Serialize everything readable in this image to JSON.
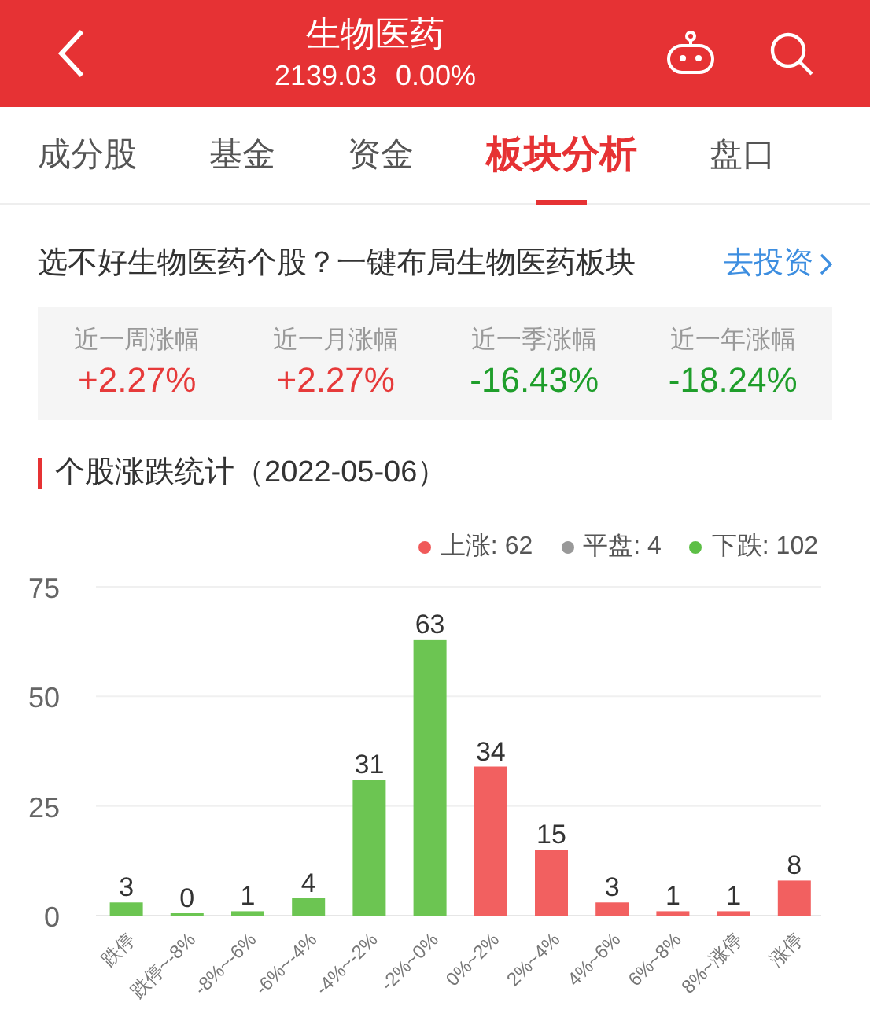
{
  "header": {
    "title": "生物医药",
    "price": "2139.03",
    "change": "0.00%"
  },
  "tabs": [
    {
      "label": "成分股",
      "selected": false
    },
    {
      "label": "基金",
      "selected": false
    },
    {
      "label": "资金",
      "selected": false
    },
    {
      "label": "板块分析",
      "selected": true
    },
    {
      "label": "盘口",
      "selected": false
    }
  ],
  "banner": {
    "text": "选不好生物医药个股？一键布局生物医药板块",
    "link": "去投资"
  },
  "stats": [
    {
      "label": "近一周涨幅",
      "value": "+2.27%",
      "color": "#e63a3a"
    },
    {
      "label": "近一月涨幅",
      "value": "+2.27%",
      "color": "#e63a3a"
    },
    {
      "label": "近一季涨幅",
      "value": "-16.43%",
      "color": "#1f9e2b"
    },
    {
      "label": "近一年涨幅",
      "value": "-18.24%",
      "color": "#1f9e2b"
    }
  ],
  "section_title": "个股涨跌统计（2022-05-06）",
  "legend": [
    {
      "label": "上涨: 62",
      "color": "#f05a5a"
    },
    {
      "label": "平盘: 4",
      "color": "#999999"
    },
    {
      "label": "下跌: 102",
      "color": "#5dbf46"
    }
  ],
  "chart_data": {
    "type": "bar",
    "categories": [
      "跌停",
      "跌停~-8%",
      "-8%~-6%",
      "-6%~-4%",
      "-4%~-2%",
      "-2%~0%",
      "0%~2%",
      "2%~4%",
      "4%~6%",
      "6%~8%",
      "8%~涨停",
      "涨停"
    ],
    "series": [
      {
        "color": "#6cc552",
        "values": [
          3,
          0,
          1,
          4,
          31,
          63,
          null,
          null,
          null,
          null,
          null,
          null
        ]
      },
      {
        "color": "#f26060",
        "values": [
          null,
          null,
          null,
          null,
          null,
          null,
          34,
          15,
          3,
          1,
          1,
          8
        ]
      }
    ],
    "ylim": [
      0,
      75
    ],
    "yticks": [
      0,
      25,
      50,
      75
    ],
    "data_labels": true,
    "stacked": true
  }
}
